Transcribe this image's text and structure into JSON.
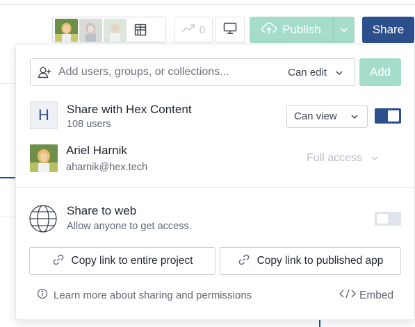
{
  "topbar": {
    "avatars": [
      "user-avatar",
      "user-avatar",
      "user-avatar"
    ],
    "trend_count": "0",
    "publish_label": "Publish",
    "share_label": "Share"
  },
  "popover": {
    "add": {
      "placeholder": "Add users, groups, or collections...",
      "permission": "Can edit",
      "add_label": "Add"
    },
    "members": [
      {
        "badge": "H",
        "name": "Share with Hex Content",
        "subtitle": "108 users",
        "permission": "Can view",
        "enabled": true
      },
      {
        "name": "Ariel Harnik",
        "subtitle": "aharnik@hex.tech",
        "permission": "Full access"
      }
    ],
    "web": {
      "title": "Share to web",
      "subtitle": "Allow anyone to get access.",
      "enabled": false
    },
    "copy_project_label": "Copy link to entire project",
    "copy_app_label": "Copy link to published app",
    "learn_more_label": "Learn more about sharing and permissions",
    "embed_label": "Embed"
  },
  "colors": {
    "primary": "#2c4f8e",
    "publish_green": "#a6dccb",
    "muted_text": "#5e6675"
  }
}
